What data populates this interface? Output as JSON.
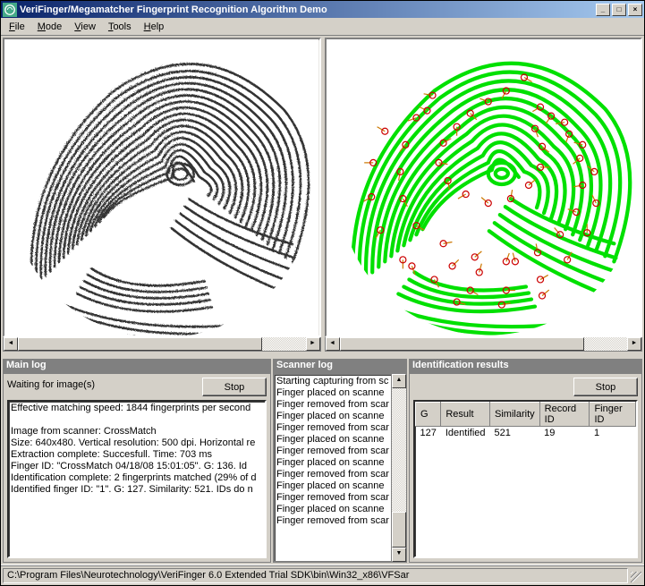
{
  "title": "VeriFinger/Megamatcher Fingerprint Recognition Algorithm Demo",
  "menus": [
    "File",
    "Mode",
    "View",
    "Tools",
    "Help"
  ],
  "panels": {
    "main_log": {
      "title": "Main log",
      "status": "Waiting for image(s)",
      "stop_label": "Stop",
      "lines": [
        "Effective matching speed: 1844 fingerprints per second",
        "",
        "Image from scanner: CrossMatch",
        "Size: 640x480. Vertical resolution: 500 dpi. Horizontal re",
        "Extraction complete: Succesfull. Time: 703 ms",
        "Finger ID: \"CrossMatch 04/18/08 15:01:05\". G: 136. Id",
        "Identification complete: 2 fingerprints matched (29% of d",
        "Identified finger ID: \"1\". G: 127. Similarity: 521. IDs do n"
      ]
    },
    "scanner_log": {
      "title": "Scanner log",
      "lines": [
        "Starting capturing from sc",
        "Finger placed on scanne",
        "Finger removed from scan",
        "Finger placed on scanne",
        "Finger removed from scan",
        "Finger placed on scanne",
        "Finger removed from scan",
        "Finger placed on scanne",
        "Finger removed from scan",
        "Finger placed on scanne",
        "Finger removed from scan",
        "Finger placed on scanne",
        "Finger removed from scan"
      ]
    },
    "results": {
      "title": "Identification results",
      "stop_label": "Stop",
      "columns": [
        "G",
        "Result",
        "Similarity",
        "Record ID",
        "Finger ID"
      ],
      "rows": [
        {
          "g": "127",
          "result": "Identified",
          "similarity": "521",
          "record_id": "19",
          "finger_id": "1"
        }
      ]
    }
  },
  "statusbar": "C:\\Program Files\\Neurotechnology\\VeriFinger 6.0 Extended Trial SDK\\bin\\Win32_x86\\VFSar",
  "minutiae": [
    [
      220,
      45,
      30
    ],
    [
      200,
      60,
      120
    ],
    [
      180,
      72,
      200
    ],
    [
      160,
      85,
      45
    ],
    [
      145,
      100,
      90
    ],
    [
      130,
      118,
      330
    ],
    [
      125,
      140,
      10
    ],
    [
      135,
      160,
      80
    ],
    [
      155,
      175,
      150
    ],
    [
      180,
      185,
      220
    ],
    [
      205,
      180,
      280
    ],
    [
      225,
      165,
      320
    ],
    [
      238,
      145,
      0
    ],
    [
      240,
      122,
      40
    ],
    [
      232,
      102,
      70
    ],
    [
      118,
      65,
      190
    ],
    [
      100,
      90,
      160
    ],
    [
      88,
      120,
      130
    ],
    [
      82,
      150,
      100
    ],
    [
      85,
      180,
      60
    ],
    [
      100,
      210,
      30
    ],
    [
      130,
      230,
      350
    ],
    [
      165,
      245,
      320
    ],
    [
      200,
      250,
      290
    ],
    [
      235,
      240,
      260
    ],
    [
      260,
      220,
      230
    ],
    [
      278,
      195,
      200
    ],
    [
      285,
      165,
      170
    ],
    [
      282,
      135,
      140
    ],
    [
      270,
      108,
      110
    ],
    [
      65,
      105,
      210
    ],
    [
      52,
      140,
      180
    ],
    [
      50,
      178,
      150
    ],
    [
      60,
      215,
      120
    ],
    [
      85,
      248,
      90
    ],
    [
      120,
      270,
      60
    ],
    [
      160,
      282,
      30
    ],
    [
      200,
      282,
      0
    ],
    [
      238,
      270,
      330
    ],
    [
      268,
      248,
      300
    ],
    [
      290,
      218,
      270
    ],
    [
      300,
      185,
      245
    ],
    [
      298,
      150,
      220
    ],
    [
      285,
      120,
      195
    ],
    [
      265,
      95,
      170
    ],
    [
      238,
      78,
      150
    ],
    [
      210,
      250,
      255
    ],
    [
      170,
      262,
      285
    ],
    [
      140,
      255,
      315
    ],
    [
      112,
      82,
      205
    ],
    [
      250,
      88,
      125
    ],
    [
      95,
      255,
      70
    ],
    [
      145,
      295,
      15
    ],
    [
      195,
      298,
      350
    ],
    [
      240,
      288,
      320
    ]
  ]
}
